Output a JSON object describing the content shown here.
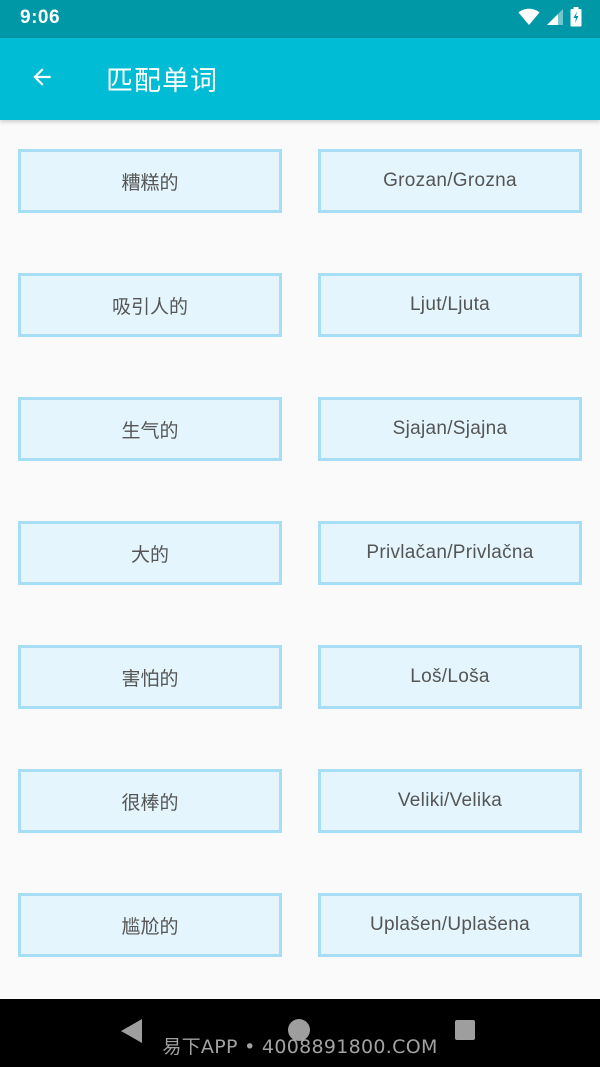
{
  "status_bar": {
    "time": "9:06",
    "icons": [
      "wifi-icon",
      "signal-icon",
      "battery-icon"
    ]
  },
  "app_bar": {
    "back_icon": "arrow-left-icon",
    "title": "匹配单词"
  },
  "colors": {
    "status_bar_bg": "#0097a7",
    "app_bar_bg": "#00bcd4",
    "card_border": "#a7ddf5",
    "card_fill": "#e4f5fd",
    "card_text": "#555555",
    "page_bg": "#fafafa",
    "nav_bar_bg": "#000000"
  },
  "pairs": [
    {
      "left": "糟糕的",
      "right": "Grozan/Grozna"
    },
    {
      "left": "吸引人的",
      "right": "Ljut/Ljuta"
    },
    {
      "left": "生气的",
      "right": "Sjajan/Sjajna"
    },
    {
      "left": "大的",
      "right": "Privlačan/Privlačna"
    },
    {
      "left": "害怕的",
      "right": "Loš/Loša"
    },
    {
      "left": "很棒的",
      "right": "Veliki/Velika"
    },
    {
      "left": "尴尬的",
      "right": "Uplašen/Uplašena"
    }
  ],
  "nav_bar": {
    "icons": [
      "triangle-back-icon",
      "circle-home-icon",
      "square-recents-icon"
    ]
  },
  "watermark": "易下APP • 4008891800.COM"
}
